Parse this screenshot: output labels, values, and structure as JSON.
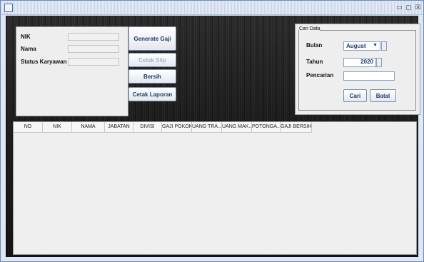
{
  "window": {
    "controls": {
      "minimize": "▭",
      "maximize": "▢",
      "close": "☒"
    }
  },
  "form": {
    "nik_label": "NIK",
    "nama_label": "Nama",
    "status_label": "Status Karyawan",
    "nik_value": "",
    "nama_value": "",
    "status_value": ""
  },
  "buttons": {
    "generate": "Generate Gaji",
    "cetak_slip": "Cetak Slip",
    "bersih": "Bersih",
    "cetak_laporan": "Cetak Laporan"
  },
  "search": {
    "group_title": "Cari Data",
    "bulan_label": "Bulan",
    "bulan_value": "August",
    "tahun_label": "Tahun",
    "tahun_value": "2020",
    "pencarian_label": "Pencarian",
    "pencarian_value": "",
    "cari_button": "Cari",
    "batal_button": "Batal"
  },
  "table": {
    "columns": [
      "NO",
      "NIK",
      "NAMA",
      "JABATAN",
      "DIVISI",
      "GAJI POKOK",
      "UANG TRA...",
      "UANG MAK...",
      "POTONGA...",
      "GAJI BERSIH"
    ],
    "rows": []
  }
}
